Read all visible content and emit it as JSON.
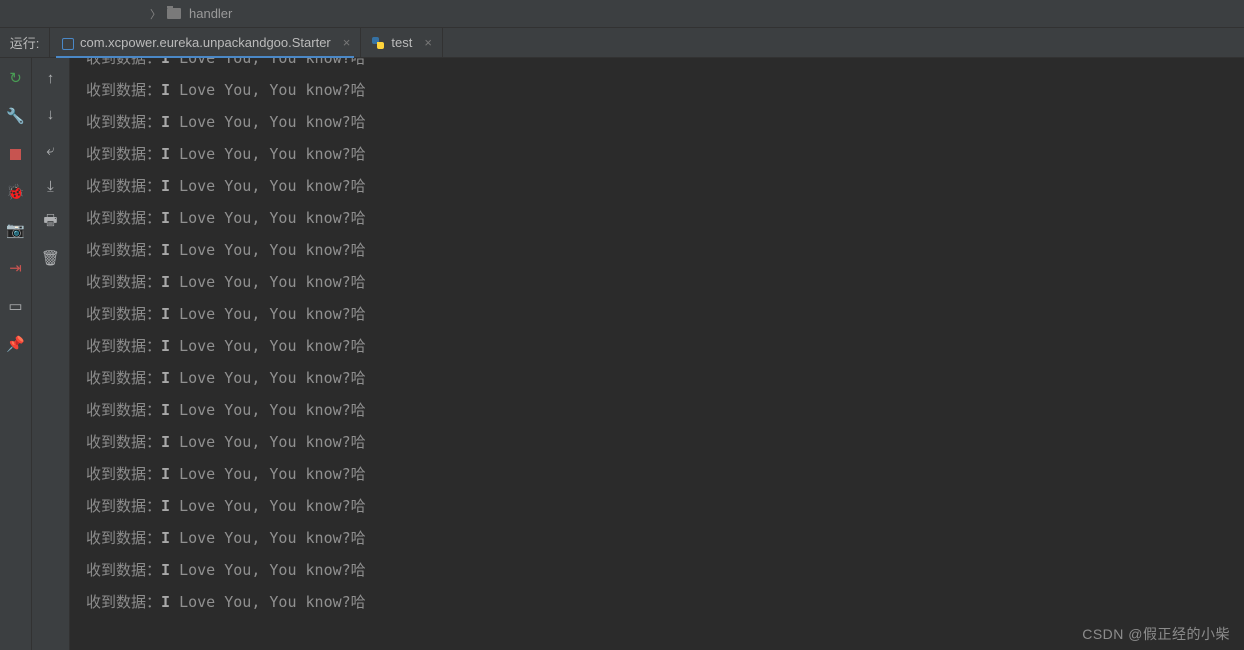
{
  "breadcrumb": {
    "chevron": "〉",
    "folder_name": "handler"
  },
  "run_panel": {
    "label": "运行:"
  },
  "tabs": [
    {
      "icon": "java-icon",
      "label": "com.xcpower.eureka.unpackandgoo.Starter",
      "active": true
    },
    {
      "icon": "python-icon",
      "label": "test",
      "active": false
    }
  ],
  "left_toolbar": [
    {
      "name": "rerun-icon",
      "glyph": "↻",
      "cls": "green"
    },
    {
      "name": "wrench-icon",
      "glyph": "🔧",
      "cls": ""
    },
    {
      "name": "stop-icon",
      "glyph": "■",
      "cls": "red"
    },
    {
      "name": "debug-bug-icon",
      "glyph": "🐞",
      "cls": "green"
    },
    {
      "name": "camera-icon",
      "glyph": "📷",
      "cls": ""
    },
    {
      "name": "exit-icon",
      "glyph": "⇥",
      "cls": "red"
    },
    {
      "name": "layout-icon",
      "glyph": "▭",
      "cls": ""
    },
    {
      "name": "pin-icon",
      "glyph": "📌",
      "cls": ""
    }
  ],
  "console_toolbar": [
    {
      "name": "up-arrow-icon",
      "glyph": "↑"
    },
    {
      "name": "down-arrow-icon",
      "glyph": "↓"
    },
    {
      "name": "soft-wrap-icon",
      "glyph": "⤶"
    },
    {
      "name": "scroll-end-icon",
      "glyph": "⤓"
    },
    {
      "name": "print-icon",
      "glyph": "🖶"
    },
    {
      "name": "trash-icon",
      "glyph": "🗑"
    }
  ],
  "console": {
    "prefix": "收到数据：",
    "bold_part": "I",
    "rest_part": " Love You, You know?哈",
    "line_count": 18,
    "first_line_cut": true
  },
  "watermark": "CSDN @假正经的小柴"
}
